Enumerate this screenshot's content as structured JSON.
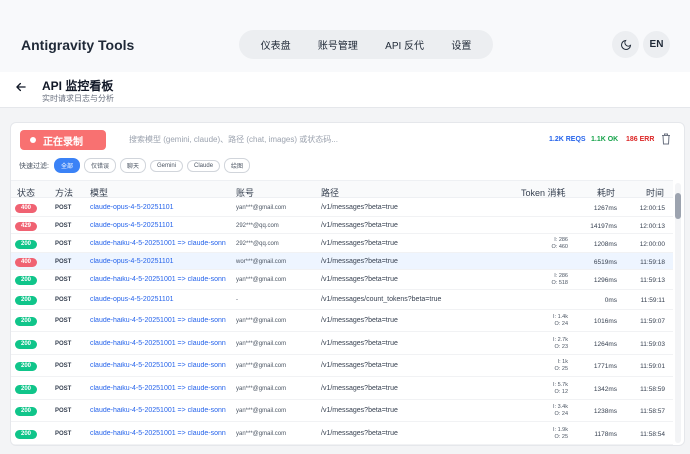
{
  "app": {
    "title": "Antigravity Tools"
  },
  "nav": {
    "items": [
      "仪表盘",
      "账号管理",
      "API 反代",
      "设置"
    ]
  },
  "header_actions": {
    "theme_icon": "moon-icon",
    "lang_label": "EN"
  },
  "page": {
    "title": "API 监控看板",
    "subtitle": "实时请求日志与分析",
    "back_icon": "arrow-left-icon"
  },
  "toolbar": {
    "record_label": "正在录制",
    "search_placeholder": "搜索模型 (gemini, claude)、路径 (chat, images) 或状态码...",
    "stats": {
      "reqs": "1.2K REQS",
      "ok": "1.1K OK",
      "err": "186 ERR"
    },
    "clear_icon": "trash-icon"
  },
  "quick_filter": {
    "label": "快速过滤:",
    "chips": [
      "全部",
      "仅错误",
      "聊天",
      "Gemini",
      "Claude",
      "绘图"
    ],
    "active": 0
  },
  "colors": {
    "error": "#f06272",
    "ok": "#10c58a",
    "accent": "#3b82f6",
    "record": "#f87171"
  },
  "table": {
    "headers": [
      "状态",
      "方法",
      "模型",
      "账号",
      "路径",
      "Token 消耗",
      "耗时",
      "时间"
    ],
    "rows": [
      {
        "status": "400",
        "method": "POST",
        "model": "claude-opus-4-5-20251101",
        "account": "yan***@gmail.com",
        "path": "/v1/messages?beta=true",
        "tok_in": "",
        "tok_out": "",
        "duration": "1267ms",
        "time": "12:00:15"
      },
      {
        "status": "429",
        "method": "POST",
        "model": "claude-opus-4-5-20251101",
        "account": "292***@qq.com",
        "path": "/v1/messages?beta=true",
        "tok_in": "",
        "tok_out": "",
        "duration": "14197ms",
        "time": "12:00:13"
      },
      {
        "status": "200",
        "method": "POST",
        "model": "claude-haiku-4-5-20251001 => claude-sonnet-4-5",
        "account": "292***@qq.com",
        "path": "/v1/messages?beta=true",
        "tok_in": "I: 286",
        "tok_out": "O: 460",
        "duration": "1208ms",
        "time": "12:00:00"
      },
      {
        "status": "400",
        "method": "POST",
        "model": "claude-opus-4-5-20251101",
        "account": "wor***@gmail.com",
        "path": "/v1/messages?beta=true",
        "tok_in": "",
        "tok_out": "",
        "duration": "6519ms",
        "time": "11:59:18"
      },
      {
        "status": "200",
        "method": "POST",
        "model": "claude-haiku-4-5-20251001 => claude-sonnet-4-5",
        "account": "yan***@gmail.com",
        "path": "/v1/messages?beta=true",
        "tok_in": "I: 286",
        "tok_out": "O: 518",
        "duration": "1296ms",
        "time": "11:59:13"
      },
      {
        "status": "200",
        "method": "POST",
        "model": "claude-opus-4-5-20251101",
        "account": "-",
        "path": "/v1/messages/count_tokens?beta=true",
        "tok_in": "",
        "tok_out": "",
        "duration": "0ms",
        "time": "11:59:11"
      },
      {
        "status": "200",
        "method": "POST",
        "model": "claude-haiku-4-5-20251001 => claude-sonnet-4-5",
        "account": "yan***@gmail.com",
        "path": "/v1/messages?beta=true",
        "tok_in": "I: 1.4k",
        "tok_out": "O: 24",
        "duration": "1016ms",
        "time": "11:59:07"
      },
      {
        "status": "200",
        "method": "POST",
        "model": "claude-haiku-4-5-20251001 => claude-sonnet-4-5",
        "account": "yan***@gmail.com",
        "path": "/v1/messages?beta=true",
        "tok_in": "I: 2.7k",
        "tok_out": "O: 23",
        "duration": "1264ms",
        "time": "11:59:03"
      },
      {
        "status": "200",
        "method": "POST",
        "model": "claude-haiku-4-5-20251001 => claude-sonnet-4-5",
        "account": "yan***@gmail.com",
        "path": "/v1/messages?beta=true",
        "tok_in": "I: 1k",
        "tok_out": "O: 25",
        "duration": "1771ms",
        "time": "11:59:01"
      },
      {
        "status": "200",
        "method": "POST",
        "model": "claude-haiku-4-5-20251001 => claude-sonnet-4-5",
        "account": "yan***@gmail.com",
        "path": "/v1/messages?beta=true",
        "tok_in": "I: 5.7k",
        "tok_out": "O: 12",
        "duration": "1342ms",
        "time": "11:58:59"
      },
      {
        "status": "200",
        "method": "POST",
        "model": "claude-haiku-4-5-20251001 => claude-sonnet-4-5",
        "account": "yan***@gmail.com",
        "path": "/v1/messages?beta=true",
        "tok_in": "I: 3.4k",
        "tok_out": "O: 24",
        "duration": "1238ms",
        "time": "11:58:57"
      },
      {
        "status": "200",
        "method": "POST",
        "model": "claude-haiku-4-5-20251001 => claude-sonnet-4-5",
        "account": "yan***@gmail.com",
        "path": "/v1/messages?beta=true",
        "tok_in": "I: 1.9k",
        "tok_out": "O: 25",
        "duration": "1178ms",
        "time": "11:58:54"
      }
    ]
  }
}
